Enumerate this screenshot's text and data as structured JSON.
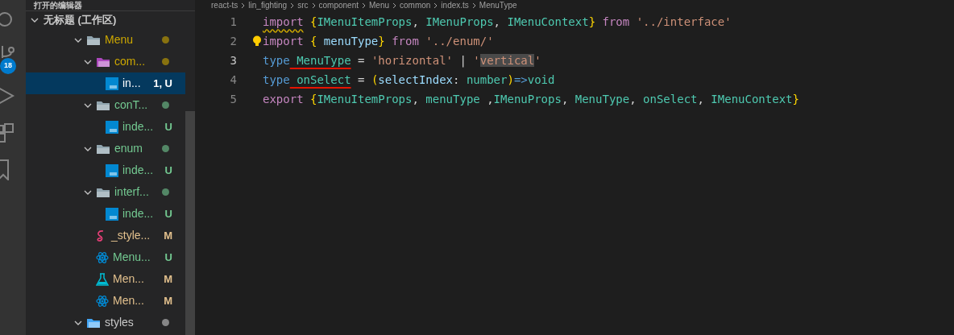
{
  "activity_bar": {
    "badge": "18"
  },
  "explorer": {
    "section": "打开的编辑器",
    "workspace": "无标题 (工作区)",
    "tree": [
      {
        "name": "Menu",
        "kind": "folder",
        "expanded": true,
        "selected": false,
        "color": "#cca700",
        "children": [
          {
            "name": "com...",
            "kind": "component-folder",
            "expanded": true,
            "selected": false,
            "color": "#cca700",
            "children": [
              {
                "name": "in...",
                "kind": "ts",
                "selected": true,
                "color": "#ffffff",
                "status": "1, U"
              }
            ]
          },
          {
            "name": "conT...",
            "kind": "folder",
            "expanded": true,
            "selected": false,
            "color": "#73c991",
            "children": [
              {
                "name": "inde...",
                "kind": "ts",
                "selected": false,
                "color": "#73c991",
                "status": "U"
              }
            ]
          },
          {
            "name": "enum",
            "kind": "folder",
            "expanded": true,
            "selected": false,
            "color": "#73c991",
            "children": [
              {
                "name": "inde...",
                "kind": "ts",
                "selected": false,
                "color": "#73c991",
                "status": "U"
              }
            ]
          },
          {
            "name": "interf...",
            "kind": "folder",
            "expanded": true,
            "selected": false,
            "color": "#73c991",
            "children": [
              {
                "name": "inde...",
                "kind": "ts",
                "selected": false,
                "color": "#73c991",
                "status": "U"
              }
            ]
          },
          {
            "name": "_style...",
            "kind": "sass",
            "selected": false,
            "color": "#e2c08d",
            "status": "M"
          },
          {
            "name": "Menu...",
            "kind": "react",
            "selected": false,
            "color": "#73c991",
            "status": "U"
          },
          {
            "name": "Men...",
            "kind": "test",
            "selected": false,
            "color": "#e2c08d",
            "status": "M"
          },
          {
            "name": "Men...",
            "kind": "react",
            "selected": false,
            "color": "#e2c08d",
            "status": "M"
          }
        ]
      },
      {
        "name": "styles",
        "kind": "styles-folder",
        "expanded": true,
        "selected": false,
        "color": "#c8c8c8"
      }
    ]
  },
  "breadcrumb": [
    "react-ts",
    "lin_fighting",
    "src",
    "component",
    "Menu",
    "common",
    "index.ts",
    "MenuType"
  ],
  "editor": {
    "lines": [
      {
        "number": "1",
        "active": false,
        "tokens": [
          {
            "text": "import",
            "kind": "keyword",
            "warning": true
          },
          {
            "text": " {",
            "kind": "brace"
          },
          {
            "text": "IMenuItemProps",
            "kind": "type"
          },
          {
            "text": ", ",
            "kind": "plain"
          },
          {
            "text": "IMenuProps",
            "kind": "type"
          },
          {
            "text": ", ",
            "kind": "plain"
          },
          {
            "text": "IMenuContext",
            "kind": "type"
          },
          {
            "text": "}",
            "kind": "brace"
          },
          {
            "text": " from",
            "kind": "keyword"
          },
          {
            "text": " '../interface'",
            "kind": "string"
          }
        ]
      },
      {
        "number": "2",
        "active": false,
        "lightbulb": true,
        "tokens": [
          {
            "text": "import",
            "kind": "keyword"
          },
          {
            "text": " {",
            "kind": "brace"
          },
          {
            "text": " menuType",
            "kind": "variable"
          },
          {
            "text": "}",
            "kind": "brace"
          },
          {
            "text": " from",
            "kind": "keyword"
          },
          {
            "text": " '../enum/'",
            "kind": "string"
          }
        ]
      },
      {
        "number": "3",
        "active": true,
        "tokens": [
          {
            "text": "type",
            "kind": "storage"
          },
          {
            "text": " MenuType",
            "kind": "type",
            "error": true
          },
          {
            "text": " = ",
            "kind": "plain"
          },
          {
            "text": "'horizontal'",
            "kind": "string"
          },
          {
            "text": " | ",
            "kind": "plain"
          },
          {
            "text": "'",
            "kind": "string"
          },
          {
            "text": "vertical",
            "kind": "string",
            "highlight": true
          },
          {
            "text": "'",
            "kind": "string"
          }
        ]
      },
      {
        "number": "4",
        "active": false,
        "tokens": [
          {
            "text": "type",
            "kind": "storage"
          },
          {
            "text": " onSelect",
            "kind": "type",
            "error": true
          },
          {
            "text": " = ",
            "kind": "plain"
          },
          {
            "text": "(",
            "kind": "brace"
          },
          {
            "text": "selectIndex",
            "kind": "variable"
          },
          {
            "text": ": ",
            "kind": "plain"
          },
          {
            "text": "number",
            "kind": "type"
          },
          {
            "text": ")",
            "kind": "brace"
          },
          {
            "text": "=>",
            "kind": "storage"
          },
          {
            "text": "void",
            "kind": "type"
          }
        ]
      },
      {
        "number": "5",
        "active": false,
        "tokens": [
          {
            "text": "export",
            "kind": "keyword"
          },
          {
            "text": " {",
            "kind": "brace"
          },
          {
            "text": "IMenuItemProps",
            "kind": "type"
          },
          {
            "text": ", ",
            "kind": "plain"
          },
          {
            "text": "menuType",
            "kind": "type"
          },
          {
            "text": " ,",
            "kind": "plain"
          },
          {
            "text": "IMenuProps",
            "kind": "type"
          },
          {
            "text": ", ",
            "kind": "plain"
          },
          {
            "text": "MenuType",
            "kind": "type"
          },
          {
            "text": ", ",
            "kind": "plain"
          },
          {
            "text": "onSelect",
            "kind": "type"
          },
          {
            "text": ", ",
            "kind": "plain"
          },
          {
            "text": "IMenuContext",
            "kind": "type"
          },
          {
            "text": "}",
            "kind": "brace"
          }
        ]
      }
    ]
  }
}
